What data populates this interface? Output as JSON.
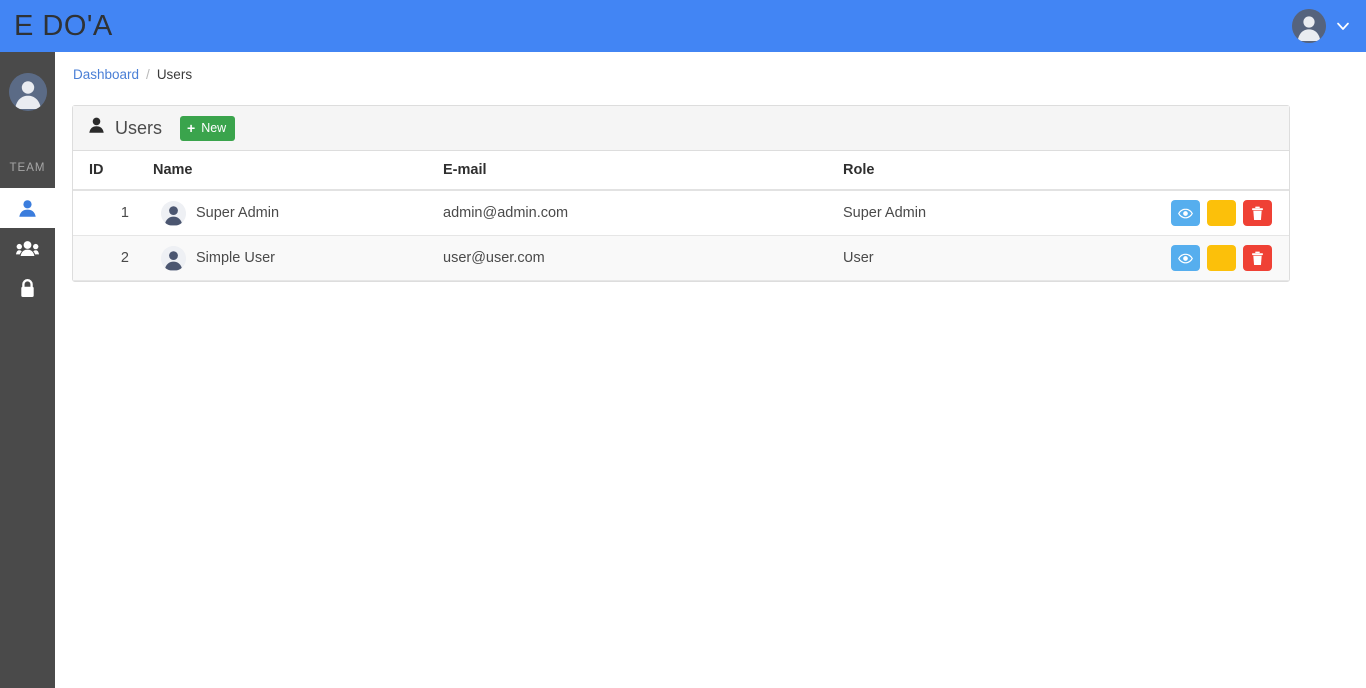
{
  "app": {
    "brand": "E DO'A",
    "accent_blue": "#4285F4",
    "sidebar_bg": "#4a4a4a",
    "green": "#3aa44c",
    "view_blue": "#56AEEE",
    "edit_yellow": "#fcc00a",
    "delete_red": "#ef4135"
  },
  "topbar": {
    "avatar_icon": "user-avatar-icon",
    "dropdown_icon": "chevron-down-icon"
  },
  "sidebar": {
    "avatar_icon": "user-avatar-icon",
    "section_label": "TEAM",
    "items": [
      {
        "label": "Users",
        "icon": "user-icon",
        "active": true
      },
      {
        "label": "Groups",
        "icon": "users-group-icon",
        "active": false
      },
      {
        "label": "Permissions",
        "icon": "lock-icon",
        "active": false
      }
    ]
  },
  "breadcrumb": {
    "items": [
      {
        "label": "Dashboard",
        "link": true
      },
      {
        "label": "Users",
        "link": false
      }
    ],
    "separator": "/"
  },
  "card": {
    "title": "Users",
    "title_icon": "person-icon",
    "new_button": {
      "label": "New",
      "icon": "plus-icon"
    }
  },
  "table": {
    "columns": [
      "ID",
      "Name",
      "E-mail",
      "Role",
      ""
    ],
    "rows": [
      {
        "id": "1",
        "name": "Super Admin",
        "email": "admin@admin.com",
        "role": "Super Admin",
        "avatar_icon": "user-avatar-icon"
      },
      {
        "id": "2",
        "name": "Simple User",
        "email": "user@user.com",
        "role": "User",
        "avatar_icon": "user-avatar-icon"
      }
    ],
    "actions": {
      "view_icon": "eye-icon",
      "edit_icon": "pencil-icon",
      "delete_icon": "trash-icon"
    }
  }
}
